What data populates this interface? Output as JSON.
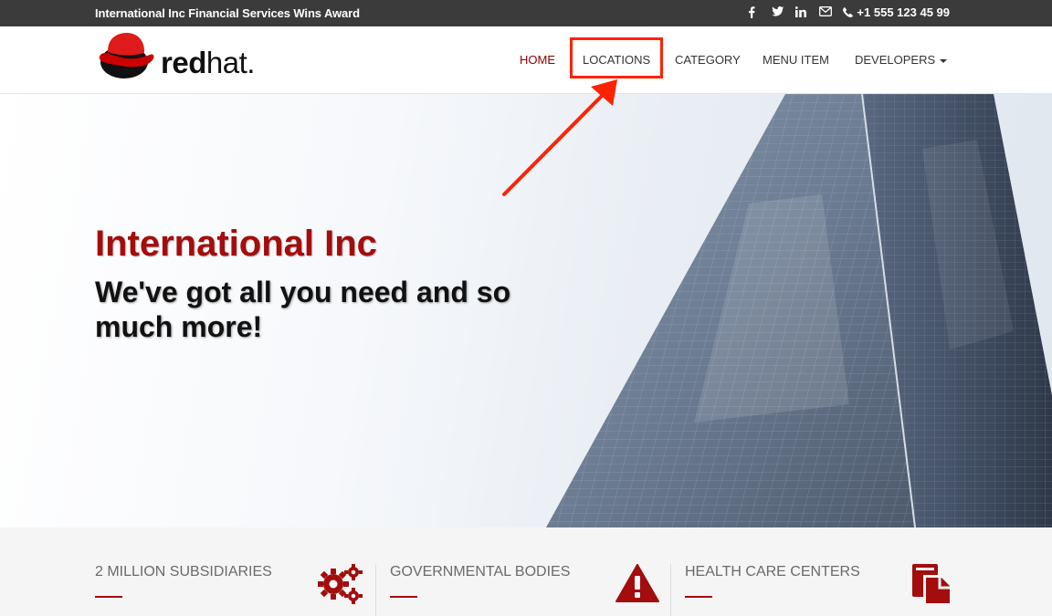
{
  "topbar": {
    "announcement": "International Inc Financial Services Wins Award",
    "social_icons": [
      "facebook-icon",
      "twitter-icon",
      "linkedin-icon",
      "envelope-icon"
    ],
    "phone": "+1 555 123 45 99"
  },
  "header": {
    "logo": {
      "red": "red",
      "hat": "hat.",
      "icon": "red-hat-shadowman-icon"
    },
    "nav": [
      {
        "label": "HOME",
        "active": true
      },
      {
        "label": "LOCATIONS",
        "active": false,
        "highlighted": true
      },
      {
        "label": "CATEGORY",
        "active": false
      },
      {
        "label": "MENU ITEM",
        "active": false
      },
      {
        "label": "DEVELOPERS",
        "active": false,
        "dropdown": true
      }
    ]
  },
  "hero": {
    "title": "International Inc",
    "subtitle": "We've got all you need and so much more!"
  },
  "features": [
    {
      "label": "2 MILLION SUBSIDIARIES",
      "icon": "gears-icon"
    },
    {
      "label": "GOVERNMENTAL BODIES",
      "icon": "warning-icon"
    },
    {
      "label": "HEALTH CARE CENTERS",
      "icon": "files-icon"
    }
  ],
  "colors": {
    "accent": "#a30d0d",
    "nav_active": "#8b0000",
    "topbar_bg": "#3b3b3b",
    "annotation": "#ff2200"
  }
}
